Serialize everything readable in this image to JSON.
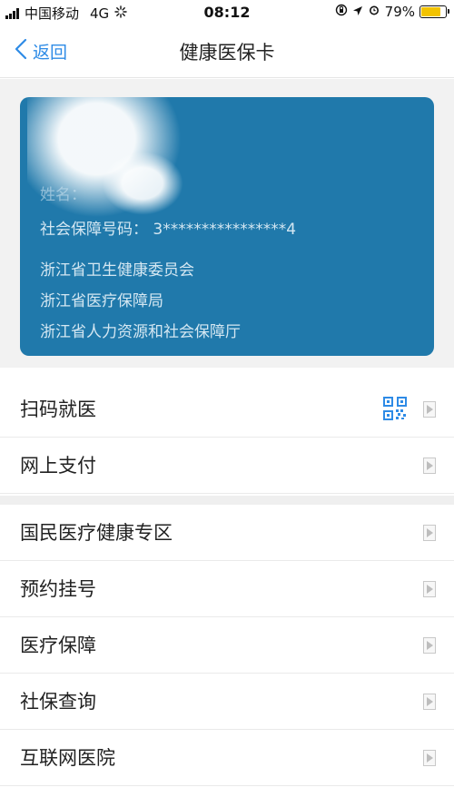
{
  "status_bar": {
    "carrier": "中国移动",
    "network": "4G",
    "time": "08:12",
    "battery": "79%",
    "battery_level": 0.79
  },
  "nav": {
    "back_label": "返回",
    "title": "健康医保卡"
  },
  "card": {
    "name_label": "姓名：",
    "id_label": "社会保障号码：",
    "id_value": "3****************4",
    "orgs": [
      "浙江省卫生健康委员会",
      "浙江省医疗保障局",
      "浙江省人力资源和社会保障厅"
    ],
    "color": "#2079ab"
  },
  "menu_group_1": [
    {
      "label": "扫码就医",
      "icon": "qr-code-icon"
    },
    {
      "label": "网上支付"
    }
  ],
  "menu_group_2": [
    {
      "label": "国民医疗健康专区"
    },
    {
      "label": "预约挂号"
    },
    {
      "label": "医疗保障"
    },
    {
      "label": "社保查询"
    },
    {
      "label": "互联网医院"
    }
  ],
  "accent_color": "#2e8be6"
}
